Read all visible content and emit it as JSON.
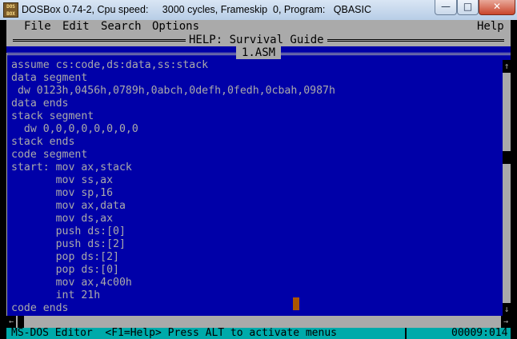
{
  "window": {
    "title": "DOSBox 0.74-2, Cpu speed:     3000 cycles, Frameskip  0, Program:   QBASIC",
    "icon_text": "DOS BOX",
    "buttons": {
      "minimize": "—",
      "maximize": "□",
      "close": "✕"
    }
  },
  "menu": {
    "items": [
      "File",
      "Edit",
      "Search",
      "Options"
    ],
    "help": "Help"
  },
  "help_window": {
    "title": "HELP: Survival Guide"
  },
  "document": {
    "tab": "1.ASM",
    "lines": [
      "assume cs:code,ds:data,ss:stack",
      "data segment",
      " dw 0123h,0456h,0789h,0abch,0defh,0fedh,0cbah,0987h",
      "data ends",
      "stack segment",
      "  dw 0,0,0,0,0,0,0,0",
      "stack ends",
      "code segment",
      "start: mov ax,stack",
      "       mov ss,ax",
      "       mov sp,16",
      "       mov ax,data",
      "       mov ds,ax",
      "       push ds:[0]",
      "       push ds:[2]",
      "       pop ds:[2]",
      "       pop ds:[0]",
      "       mov ax,4c00h",
      "       int 21h",
      "code ends"
    ]
  },
  "scrollbars": {
    "up_arrow": "↑",
    "down_arrow": "↓",
    "left_arrow": "←",
    "right_arrow": "→"
  },
  "status": {
    "text": "MS-DOS Editor  <F1=Help> Press ALT to activate menus",
    "position": "00009:014"
  },
  "colors": {
    "dos_blue": "#0000a8",
    "dos_gray": "#aaaaaa",
    "status_cyan": "#00aaaa",
    "cursor_brown": "#aa5500"
  }
}
